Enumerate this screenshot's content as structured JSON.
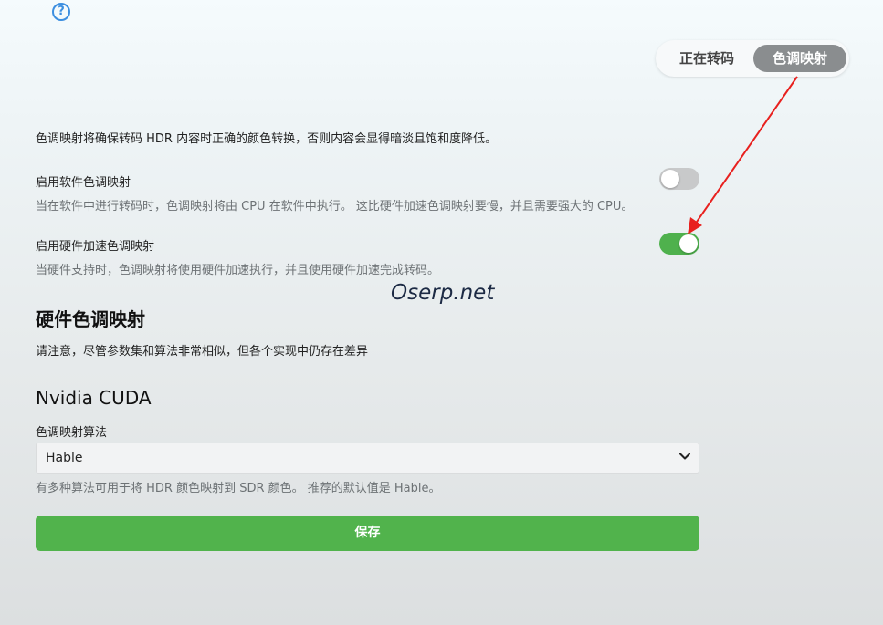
{
  "help": {
    "glyph": "?"
  },
  "tabs": [
    {
      "label": "正在转码",
      "active": false
    },
    {
      "label": "色调映射",
      "active": true
    }
  ],
  "intro": "色调映射将确保转码 HDR 内容时正确的颜色转换，否则内容会显得暗淡且饱和度降低。",
  "settings": [
    {
      "title": "启用软件色调映射",
      "desc": "当在软件中进行转码时，色调映射将由 CPU 在软件中执行。 这比硬件加速色调映射要慢，并且需要强大的 CPU。",
      "enabled": false
    },
    {
      "title": "启用硬件加速色调映射",
      "desc": "当硬件支持时，色调映射将使用硬件加速执行，并且使用硬件加速完成转码。",
      "enabled": true
    }
  ],
  "watermark": "Oserp.net",
  "hardware": {
    "title": "硬件色调映射",
    "note": "请注意，尽管参数集和算法非常相似，但各个实现中仍存在差异"
  },
  "cuda": {
    "title": "Nvidia CUDA",
    "algo_label": "色调映射算法",
    "algo_value": "Hable",
    "algo_desc": "有多种算法可用于将 HDR 颜色映射到 SDR 颜色。 推荐的默认值是 Hable。"
  },
  "save_label": "保存",
  "colors": {
    "accent_green": "#51b34c",
    "toggle_on": "#4fb14d",
    "toggle_off": "#c8c9ca",
    "tab_active": "#8a8d8f",
    "help_blue": "#3d8fe0",
    "annotation_red": "#e8201e"
  }
}
